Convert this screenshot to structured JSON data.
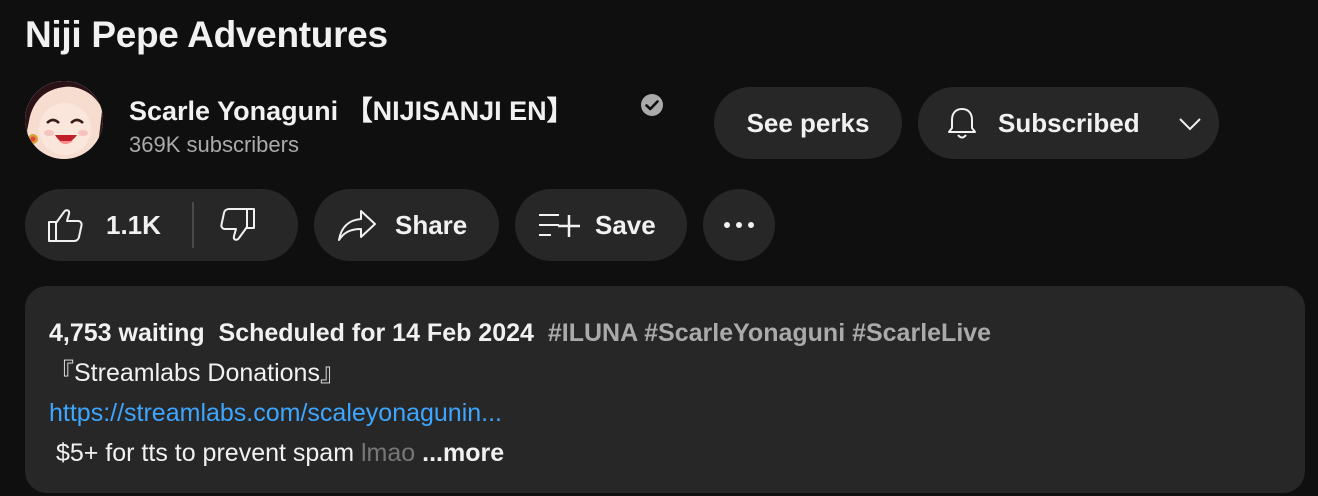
{
  "video": {
    "title": "Niji Pepe Adventures"
  },
  "channel": {
    "name": "Scarle Yonaguni 【NIJISANJI EN】",
    "subscribers": "369K subscribers",
    "verified_icon": "check-circle-icon"
  },
  "actions": {
    "see_perks": "See perks",
    "subscribed": "Subscribed",
    "like_count": "1.1K",
    "share": "Share",
    "save": "Save",
    "more": "···"
  },
  "description": {
    "waiting": "4,753 waiting",
    "scheduled": "Scheduled for 14 Feb 2024",
    "hashtags": "#ILUNA #ScarleYonaguni #ScarleLive",
    "line2": "『Streamlabs Donations』",
    "link": "https://streamlabs.com/scaleyonagunin...",
    "line4_main": "$5+ for tts to prevent spam ",
    "line4_fade": "lmao",
    "more_label": "...more"
  },
  "colors": {
    "background": "#0f0f0f",
    "button": "#272727",
    "link": "#3ea6ff",
    "secondary_text": "#aaaaaa"
  }
}
